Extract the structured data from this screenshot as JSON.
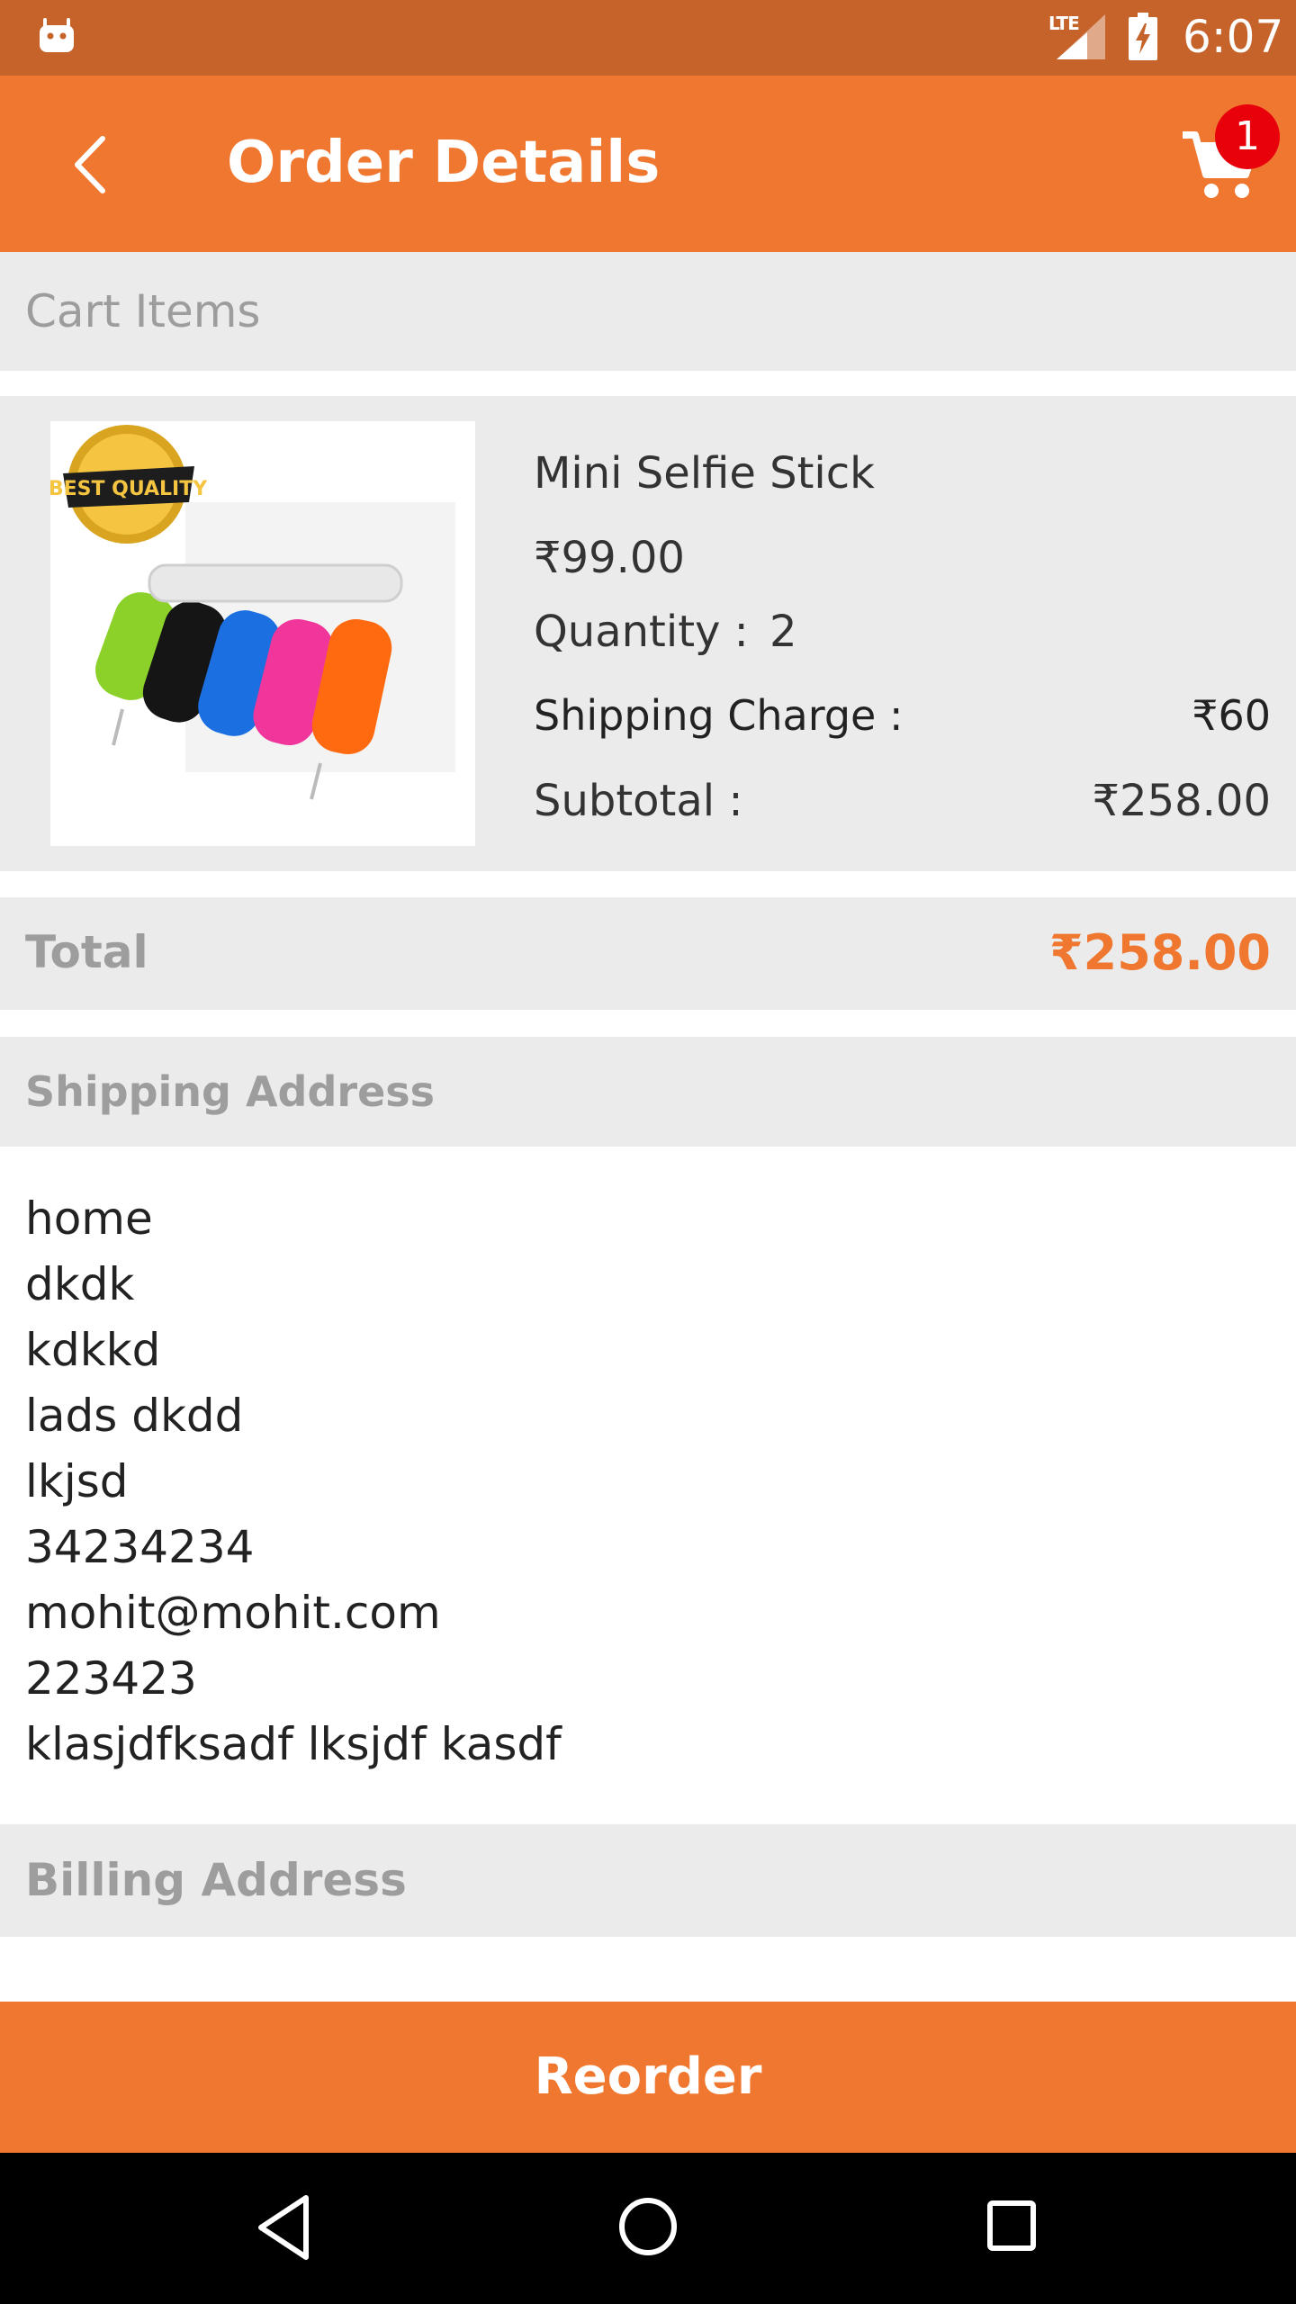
{
  "status_bar": {
    "network_label": "LTE",
    "time": "6:07"
  },
  "app_bar": {
    "title": "Order Details",
    "cart_count": "1"
  },
  "cart_section": {
    "header": "Cart Items",
    "item": {
      "name": "Mini Selfie Stick",
      "price": "₹99.00",
      "quantity_label": "Quantity :",
      "quantity_value": "2",
      "shipping_label": "Shipping Charge :",
      "shipping_value": "₹60",
      "subtotal_label": "Subtotal :",
      "subtotal_value": "₹258.00",
      "image_badge_text": "BEST QUALITY"
    }
  },
  "total": {
    "label": "Total",
    "value": "₹258.00"
  },
  "shipping_address": {
    "header": "Shipping Address",
    "lines": [
      "home",
      "dkdk",
      "kdkkd",
      "lads dkdd",
      "lkjsd",
      "34234234",
      "mohit@mohit.com",
      "223423",
      "klasjdfksadf lksjdf kasdf"
    ]
  },
  "billing_address": {
    "header": "Billing Address"
  },
  "reorder_button": "Reorder",
  "icons": {
    "back": "back-arrow-icon",
    "cart": "shopping-cart-icon",
    "android": "android-icon",
    "signal": "signal-icon",
    "battery": "battery-charging-icon",
    "nav_back": "triangle-back-icon",
    "nav_home": "circle-home-icon",
    "nav_recent": "square-recent-icon"
  },
  "colors": {
    "accent": "#ef772f",
    "status_bar": "#c5632a",
    "badge": "#e8000b",
    "section_bg": "#ebebeb",
    "muted_text": "#9d9d9d"
  }
}
